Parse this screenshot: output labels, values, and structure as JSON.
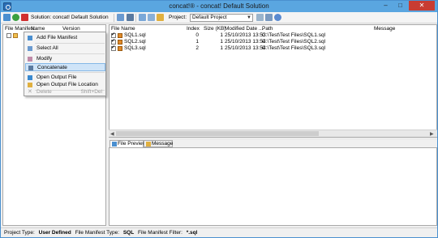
{
  "window": {
    "title": "concat!® - concat! Default Solution"
  },
  "toolbar": {
    "solution_label": "Solution:",
    "solution_name": "concat! Default Solution",
    "project_label": "Project:",
    "project_value": "Default Project"
  },
  "left_panel": {
    "headers": [
      "File Manifest",
      "Name",
      "Version"
    ],
    "row": {
      "name": "",
      "version": ""
    }
  },
  "context_menu": {
    "items": [
      {
        "label": "Add File Manifest",
        "icon": "add-file-icon"
      },
      {
        "label": "Select All",
        "icon": "select-all-icon"
      },
      {
        "label": "Modify",
        "icon": "modify-icon"
      },
      {
        "label": "Concatenate",
        "icon": "concatenate-icon"
      },
      {
        "label": "Open Output File",
        "icon": "open-file-icon"
      },
      {
        "label": "Open Output File Location",
        "icon": "folder-icon"
      },
      {
        "label": "Delete",
        "icon": "delete-icon",
        "shortcut": "Shift+Del"
      }
    ]
  },
  "file_list": {
    "headers": [
      "File Name",
      "Index",
      "Size (KB)",
      "Modified Date ...",
      "Path",
      "Message"
    ],
    "rows": [
      {
        "name": "SQL1.sql",
        "index": "0",
        "size": "1",
        "modified": "25/10/2013 13:53",
        "path": "C:\\Test\\Test Files\\SQL1.sql",
        "message": ""
      },
      {
        "name": "SQL2.sql",
        "index": "1",
        "size": "1",
        "modified": "25/10/2013 13:54",
        "path": "C:\\Test\\Test Files\\SQL2.sql",
        "message": ""
      },
      {
        "name": "SQL3.sql",
        "index": "2",
        "size": "1",
        "modified": "25/10/2013 13:54",
        "path": "C:\\Test\\Test Files\\SQL3.sql",
        "message": ""
      }
    ]
  },
  "tabs": {
    "file_preview": "File Preview",
    "message": "Message"
  },
  "status": {
    "project_type_label": "Project Type:",
    "project_type_value": "User Defined",
    "manifest_type_label": "File Manifest Type:",
    "manifest_type_value": "SQL",
    "filter_label": "File Manifest Filter:",
    "filter_value": "*.sql"
  },
  "colors": {
    "titlebar": "#5aa6e0",
    "close_button": "#c83c32",
    "menu_highlight": "#cfe4f8"
  }
}
